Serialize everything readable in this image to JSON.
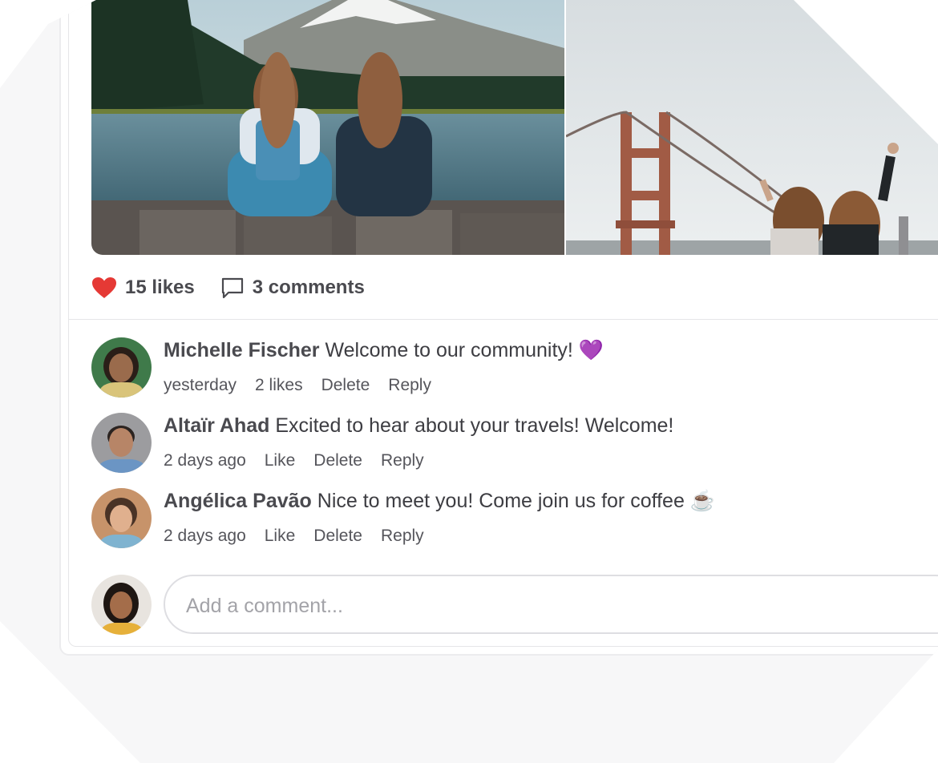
{
  "colors": {
    "heart": "#e53935",
    "text_primary": "#4a4a4f",
    "text_meta": "#55555b",
    "placeholder": "#a3a3a8",
    "border": "#e6e6e8"
  },
  "post": {
    "images": [
      {
        "icon": "photo-lake-mountain"
      },
      {
        "icon": "photo-bridge"
      }
    ],
    "likes_label": "15 likes",
    "comments_label": "3 comments"
  },
  "comments": [
    {
      "author": "Michelle Fischer",
      "text": "Welcome to our community! 💜",
      "time": "yesterday",
      "likes": "2 likes",
      "delete": "Delete",
      "reply": "Reply"
    },
    {
      "author": "Altaïr Ahad",
      "text": "Excited to hear about your travels! Welcome!",
      "time": "2 days ago",
      "likes": "Like",
      "delete": "Delete",
      "reply": "Reply"
    },
    {
      "author": "Angélica Pavão",
      "text": "Nice to meet you! Come join us for coffee ☕",
      "time": "2 days ago",
      "likes": "Like",
      "delete": "Delete",
      "reply": "Reply"
    }
  ],
  "composer": {
    "placeholder": "Add a comment..."
  }
}
